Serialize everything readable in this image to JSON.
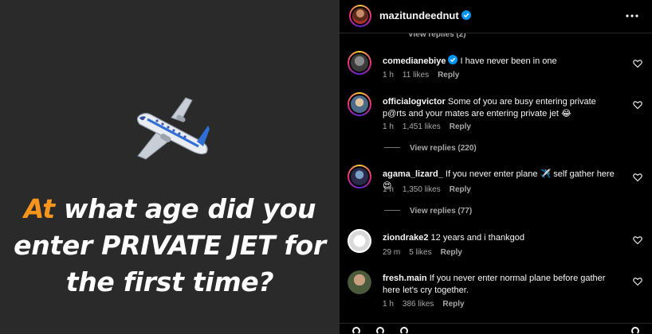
{
  "post": {
    "headline_accent": "At",
    "headline_rest": " what age did you enter PRIVATE JET for the first time?",
    "plane_icon": "airplane-icon"
  },
  "header": {
    "username": "mazitundeednut",
    "hidden_replies": "View replies (2)"
  },
  "comments": [
    {
      "user": "comedianebiye",
      "verified": true,
      "text": "I have never been in one",
      "time": "1 h",
      "likes": "11 likes",
      "reply": "Reply"
    },
    {
      "user": "officialogvictor",
      "verified": false,
      "text": "Some of you are busy entering private p@rts and your mates are entering private jet 😂",
      "time": "1 h",
      "likes": "1,451 likes",
      "reply": "Reply",
      "view_replies": "View replies (220)"
    },
    {
      "user": "agama_lizard_",
      "verified": false,
      "text": "If you never enter plane ✈️ self gather here 😍",
      "time": "1 h",
      "likes": "1,350 likes",
      "reply": "Reply",
      "view_replies": "View replies (77)"
    },
    {
      "user": "ziondrake2",
      "verified": false,
      "text": "12 years and i thankgod",
      "time": "29 m",
      "likes": "5 likes",
      "reply": "Reply"
    },
    {
      "user": "fresh.main",
      "verified": false,
      "text": "If you never enter normal plane before gather here let's cry together.",
      "time": "1 h",
      "likes": "386 likes",
      "reply": "Reply"
    }
  ],
  "colors": {
    "accent": "#f7941d",
    "verified": "#0095f6",
    "panel_bg": "#000000",
    "post_bg": "#2a2a2a"
  }
}
